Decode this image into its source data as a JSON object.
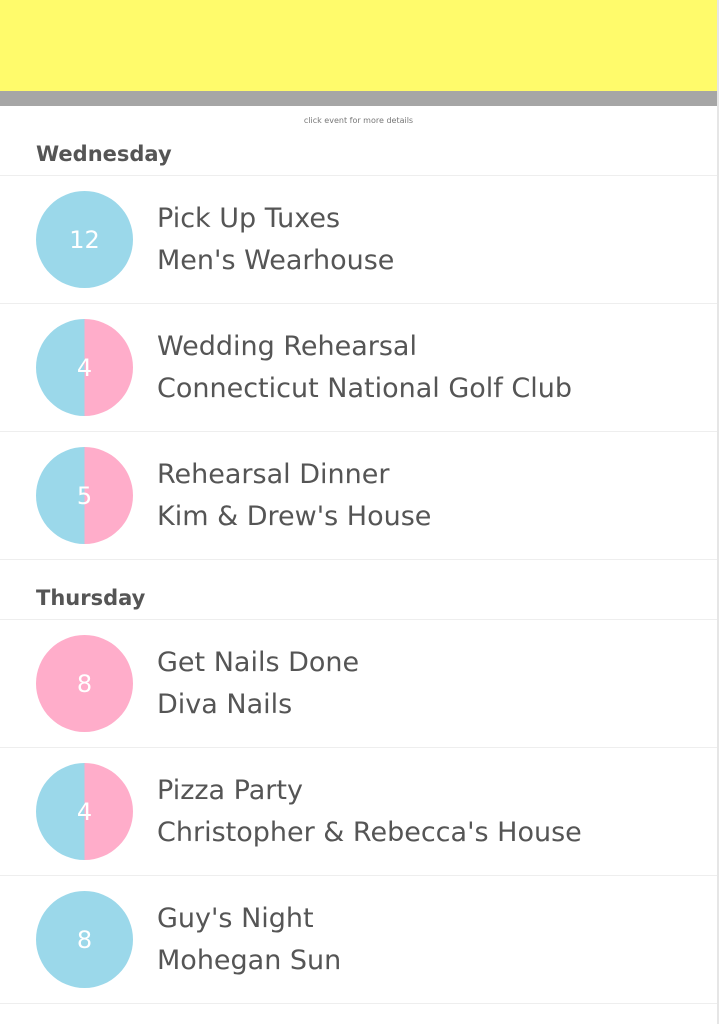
{
  "header": {
    "banner_color": "#fffb6b",
    "bar_color": "#a6a6a6"
  },
  "hint_text": "click event for more details",
  "colors": {
    "blue": "#9bd8ea",
    "pink": "#ffadca"
  },
  "days": [
    {
      "name": "Wednesday",
      "events": [
        {
          "count": "12",
          "title": "Pick Up Tuxes",
          "location": "Men's Wearhouse",
          "badge_style": "blue"
        },
        {
          "count": "4",
          "title": "Wedding Rehearsal",
          "location": "Connecticut National Golf Club",
          "badge_style": "split"
        },
        {
          "count": "5",
          "title": "Rehearsal Dinner",
          "location": "Kim & Drew's House",
          "badge_style": "split"
        }
      ]
    },
    {
      "name": "Thursday",
      "events": [
        {
          "count": "8",
          "title": "Get Nails Done",
          "location": "Diva Nails",
          "badge_style": "pink"
        },
        {
          "count": "4",
          "title": "Pizza Party",
          "location": "Christopher & Rebecca's House",
          "badge_style": "split"
        },
        {
          "count": "8",
          "title": "Guy's Night",
          "location": "Mohegan Sun",
          "badge_style": "blue"
        }
      ]
    }
  ]
}
